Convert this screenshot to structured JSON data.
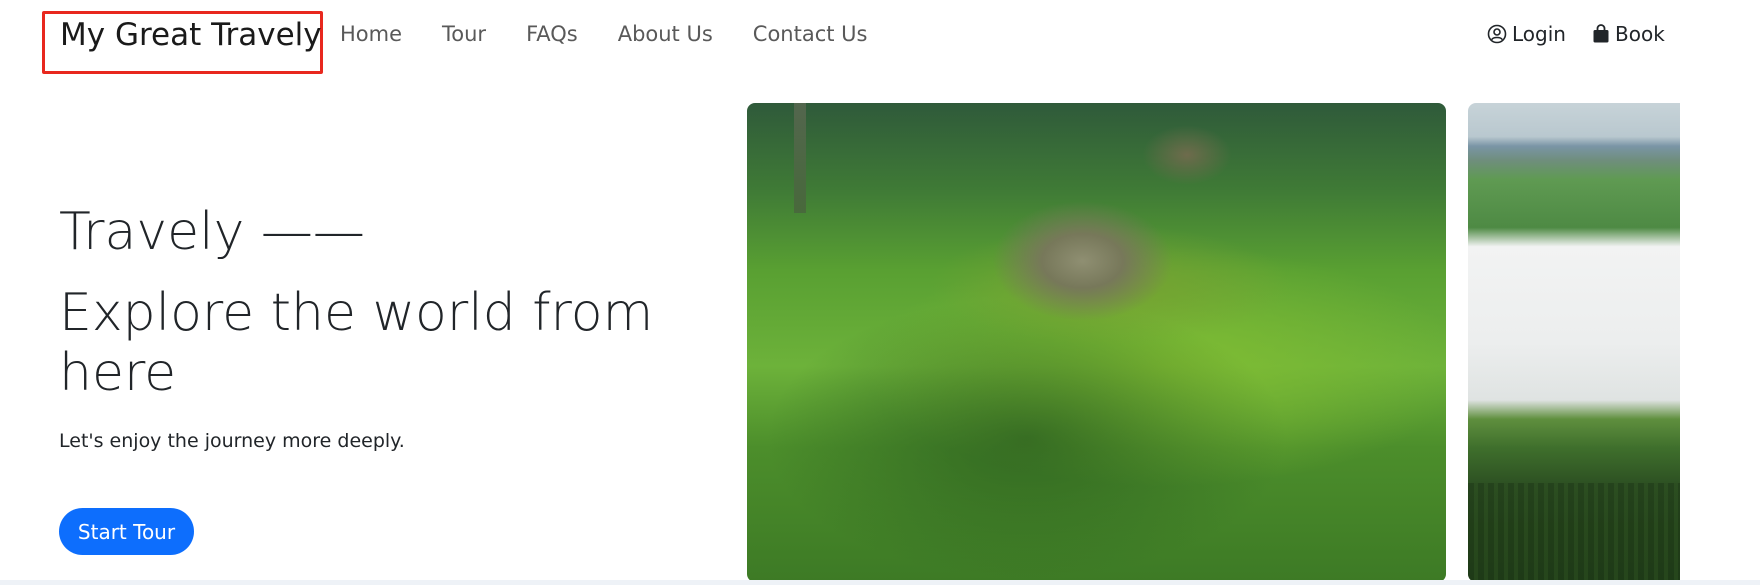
{
  "brand": {
    "name": "My Great Travely"
  },
  "nav": {
    "links": [
      "Home",
      "Tour",
      "FAQs",
      "About Us",
      "Contact Us"
    ],
    "login_label": "Login",
    "book_label": "Book"
  },
  "hero": {
    "title": "Travely ——",
    "subtitle": "Explore the world from here",
    "lead": "Let's enjoy the journey more deeply.",
    "cta_label": "Start Tour"
  },
  "icons": {
    "login": "user-circle-icon",
    "book": "shopping-bag-icon"
  },
  "colors": {
    "accent": "#0d6efd",
    "brand_highlight_border": "#e8281e"
  }
}
